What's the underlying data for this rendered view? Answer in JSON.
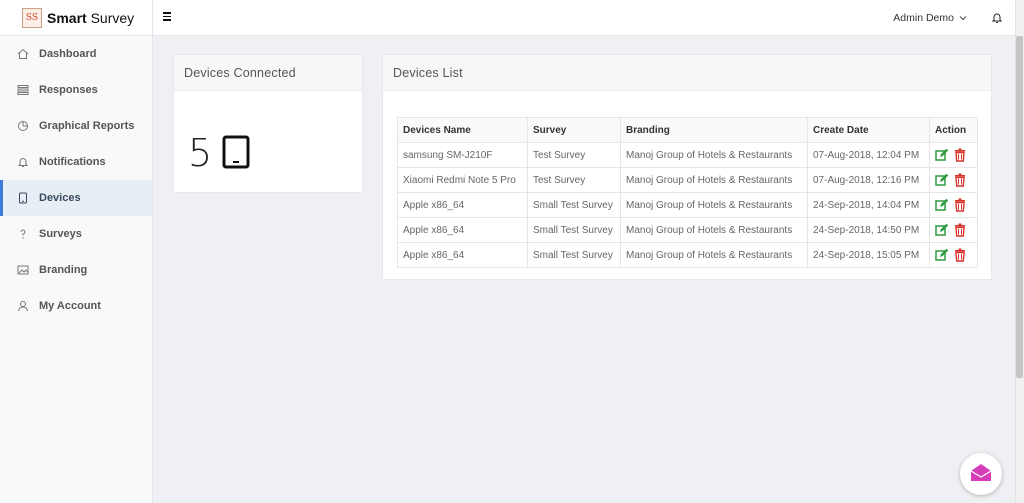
{
  "brand": {
    "logo_text": "SS",
    "name_bold": "Smart",
    "name_rest": " Survey"
  },
  "sidebar": {
    "items": [
      {
        "label": "Dashboard",
        "icon": "home-icon"
      },
      {
        "label": "Responses",
        "icon": "list-icon"
      },
      {
        "label": "Graphical Reports",
        "icon": "pie-chart-icon"
      },
      {
        "label": "Notifications",
        "icon": "bell-icon"
      },
      {
        "label": "Devices",
        "icon": "tablet-icon",
        "active": true
      },
      {
        "label": "Surveys",
        "icon": "question-icon"
      },
      {
        "label": "Branding",
        "icon": "image-icon"
      },
      {
        "label": "My Account",
        "icon": "user-icon"
      }
    ]
  },
  "topbar": {
    "user_name": "Admin Demo",
    "chevron": "⌄"
  },
  "devices_connected": {
    "title": "Devices Connected",
    "count": "5"
  },
  "devices_list": {
    "title": "Devices List",
    "columns": [
      "Devices Name",
      "Survey",
      "Branding",
      "Create Date",
      "Action"
    ],
    "rows": [
      {
        "name": "samsung SM-J210F",
        "survey": "Test Survey",
        "branding": "Manoj Group of Hotels & Restaurants",
        "date": "07-Aug-2018, 12:04 PM"
      },
      {
        "name": "Xiaomi Redmi Note 5 Pro",
        "survey": "Test Survey",
        "branding": "Manoj Group of Hotels & Restaurants",
        "date": "07-Aug-2018, 12:16 PM"
      },
      {
        "name": "Apple x86_64",
        "survey": "Small Test Survey",
        "branding": "Manoj Group of Hotels & Restaurants",
        "date": "24-Sep-2018, 14:04 PM"
      },
      {
        "name": "Apple x86_64",
        "survey": "Small Test Survey",
        "branding": "Manoj Group of Hotels & Restaurants",
        "date": "24-Sep-2018, 14:50 PM"
      },
      {
        "name": "Apple x86_64",
        "survey": "Small Test Survey",
        "branding": "Manoj Group of Hotels & Restaurants",
        "date": "24-Sep-2018, 15:05 PM"
      }
    ]
  },
  "colors": {
    "edit": "#2e9b3f",
    "delete": "#d9342b",
    "accent": "#3a7bd5",
    "chat": "#d63bb8"
  }
}
